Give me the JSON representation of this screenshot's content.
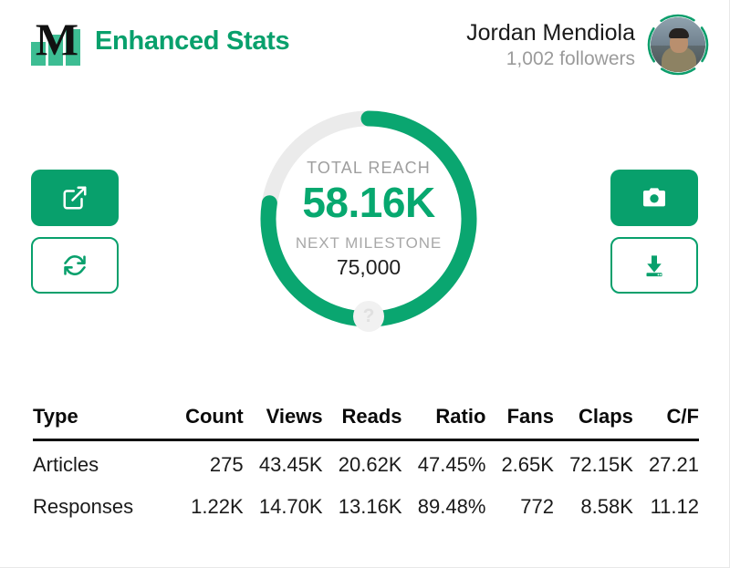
{
  "header": {
    "logo_letter": "M",
    "logo_icon": "medium-bars-logo",
    "app_title": "Enhanced Stats",
    "user_name": "Jordan Mendiola",
    "followers": "1,002 followers",
    "avatar_alt": "Jordan Mendiola avatar"
  },
  "actions": {
    "open_icon": "external-link-icon",
    "refresh_icon": "refresh-icon",
    "camera_icon": "camera-icon",
    "save_icon": "download-icon"
  },
  "gauge": {
    "total_reach_label": "TOTAL REACH",
    "total_reach_value": "58.16K",
    "next_milestone_label": "NEXT MILESTONE",
    "next_milestone_value": "75,000",
    "help_glyph": "?",
    "progress_percent": 77.5,
    "track_color": "#ebebeb",
    "arc_color": "#0aa670"
  },
  "table": {
    "columns": [
      "Type",
      "Count",
      "Views",
      "Reads",
      "Ratio",
      "Fans",
      "Claps",
      "C/F"
    ],
    "rows": [
      {
        "type": "Articles",
        "count": "275",
        "views": "43.45K",
        "reads": "20.62K",
        "ratio": "47.45%",
        "fans": "2.65K",
        "claps": "72.15K",
        "cf": "27.21"
      },
      {
        "type": "Responses",
        "count": "1.22K",
        "views": "14.70K",
        "reads": "13.16K",
        "ratio": "89.48%",
        "fans": "772",
        "claps": "8.58K",
        "cf": "11.12"
      }
    ]
  },
  "colors": {
    "brand_green": "#08a06c",
    "logo_bar_green": "#3dbd93",
    "value_green": "#07a86f",
    "muted_gray": "#9e9e9e"
  }
}
